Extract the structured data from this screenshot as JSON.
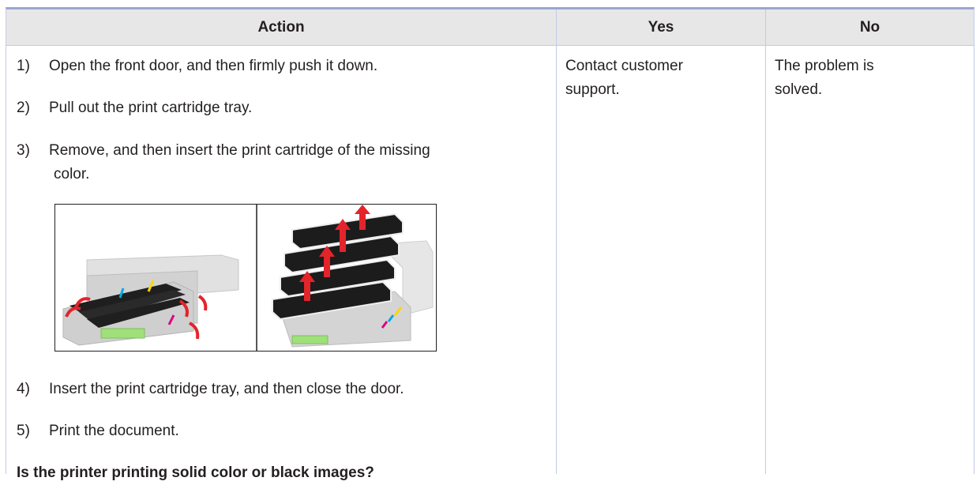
{
  "table": {
    "headers": {
      "action": "Action",
      "yes": "Yes",
      "no": "No"
    },
    "steps": [
      {
        "num": "1)",
        "text": "Open the front door, and then firmly push it down."
      },
      {
        "num": "2)",
        "text": "Pull out the print cartridge tray."
      },
      {
        "num": "3)",
        "text": "Remove, and then insert the print cartridge of the missing",
        "continuation": "color."
      },
      {
        "num": "4)",
        "text": "Insert the print cartridge tray, and then close the door."
      },
      {
        "num": "5)",
        "text": "Print the document."
      }
    ],
    "question": "Is the printer printing solid color or black images?",
    "yes_cell": {
      "line1": "Contact customer",
      "line2": "support."
    },
    "no_cell": {
      "line1": "The problem is",
      "line2": "solved."
    }
  },
  "figure": {
    "panels": [
      "cartridge-tray-pulled-out",
      "cartridges-removed-upward"
    ],
    "colors": {
      "arrow": "#e3242b",
      "green_label": "#9fe07a",
      "cartridge": "#1f1f1f",
      "body": "#d9d9d9"
    }
  }
}
